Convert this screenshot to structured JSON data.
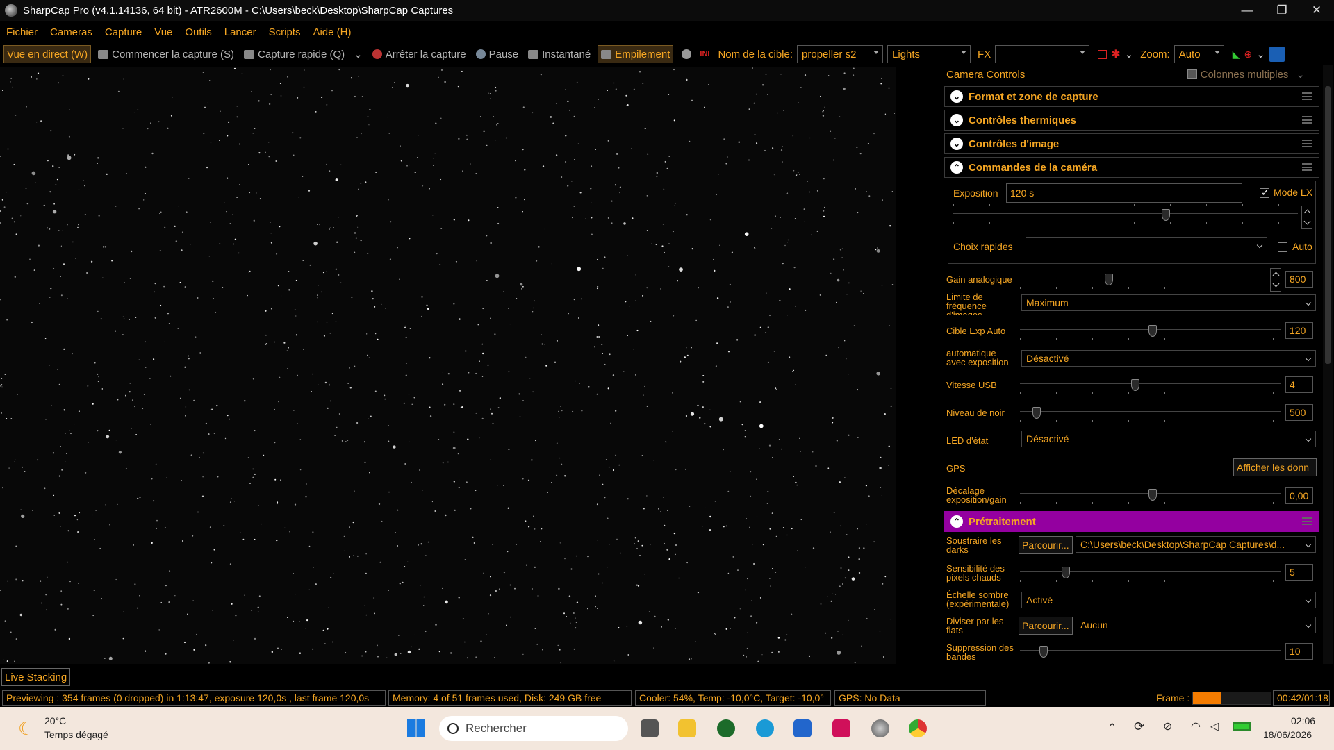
{
  "titlebar": {
    "title": "SharpCap Pro (v4.1.14136, 64 bit) - ATR2600M - C:\\Users\\beck\\Desktop\\SharpCap Captures"
  },
  "menu": [
    "Fichier",
    "Cameras",
    "Capture",
    "Vue",
    "Outils",
    "Lancer",
    "Scripts",
    "Aide (H)"
  ],
  "toolbar": {
    "live": "Vue en direct (W)",
    "start": "Commencer la capture (S)",
    "quick": "Capture rapide (Q)",
    "stop": "Arrêter la capture",
    "pause": "Pause",
    "snapshot": "Instantané",
    "stack": "Empilement",
    "target_label": "Nom de la cible:",
    "target_value": "propeller s2",
    "frame_type": "Lights",
    "fx": "FX",
    "fx_value": "",
    "zoom_label": "Zoom:",
    "zoom_value": "Auto"
  },
  "panel": {
    "title": "Camera Controls",
    "multi": "Colonnes multiples",
    "sections": {
      "format": "Format et zone de capture",
      "thermal": "Contrôles thermiques",
      "image": "Contrôles d'image",
      "camera": "Commandes de la caméra",
      "pre": "Prétraitement"
    },
    "exposure_label": "Exposition",
    "exposure_value": "120 s",
    "lx": "Mode LX",
    "quick_label": "Choix rapides",
    "quick_value": "",
    "auto": "Auto",
    "gain_label": "Gain analogique",
    "gain_value": "800",
    "fps_label": "Limite de fréquence d'images",
    "fps_value": "Maximum",
    "autoexp_label": "Cible Exp Auto",
    "autoexp_value": "120",
    "autoexpo_label": "automatique avec exposition",
    "autoexpo_value": "Désactivé",
    "usb_label": "Vitesse USB",
    "usb_value": "4",
    "black_label": "Niveau de noir",
    "black_value": "500",
    "led_label": "LED d'état",
    "led_value": "Désactivé",
    "gps_label": "GPS",
    "gps_button": "Afficher les donn",
    "offset_label": "Décalage exposition/gain",
    "offset_value": "0,00",
    "darks_label": "Soustraire les darks",
    "browse": "Parcourir...",
    "darks_value": "C:\\Users\\beck\\Desktop\\SharpCap Captures\\d...",
    "hot_label": "Sensibilité des pixels chauds",
    "hot_value": "5",
    "dark_scale_label": "Échelle sombre (expérimentale)",
    "dark_scale_value": "Activé",
    "flats_label": "Diviser par les flats",
    "flats_value": "Aucun",
    "banding_label": "Suppression des bandes",
    "banding_value": "10"
  },
  "live_stacking": "Live Stacking",
  "status": {
    "preview": "Previewing : 354 frames (0 dropped) in 1:13:47, exposure 120,0s , last frame 120,0s",
    "memory": "Memory: 4 of 51 frames used, Disk: 249 GB free",
    "cooler": "Cooler: 54%, Temp: -10,0°C, Target: -10,0°",
    "gps": "GPS: No Data",
    "frame_label": "Frame :",
    "frame_progress": 0.36,
    "frame_time": "00:42/01:18"
  },
  "taskbar": {
    "temp": "20°C",
    "weather": "Temps dégagé",
    "search": "Rechercher",
    "time": "02:06",
    "date": "18/06/2026"
  },
  "colors": {
    "accent": "#f5a623",
    "pre_section": "#9400a0"
  }
}
